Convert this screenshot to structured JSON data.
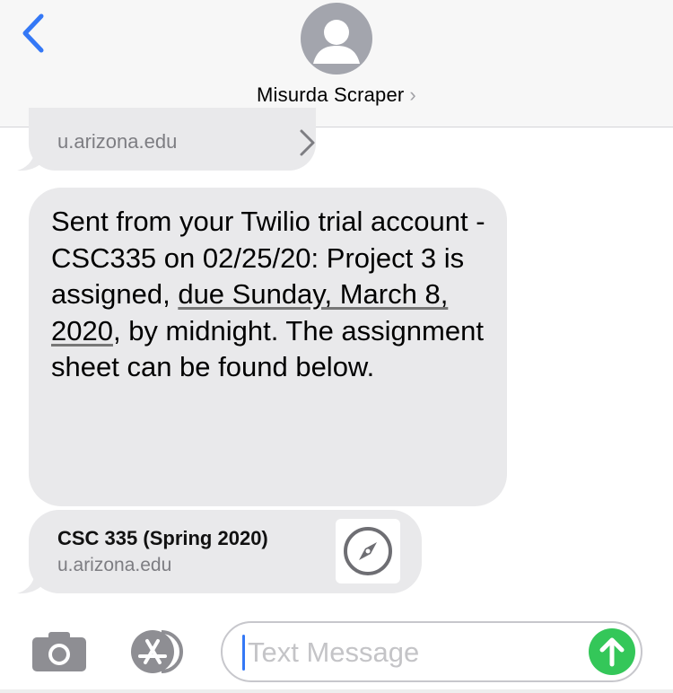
{
  "header": {
    "contact_name": "Misurda Scraper",
    "chevron": "›"
  },
  "messages": {
    "link_preview_top": {
      "domain": "u.arizona.edu"
    },
    "body": {
      "part1": "Sent from your Twilio trial account - CSC335 on 02/25/20: Project 3 is assigned, ",
      "date_link": "due Sunday, March 8, 2020",
      "part2": ", by midnight. The assignment sheet can be found below."
    },
    "link_card": {
      "title": "CSC 335 (Spring 2020)",
      "domain": "u.arizona.edu"
    }
  },
  "input_bar": {
    "placeholder": "Text Message"
  },
  "colors": {
    "accent": "#3478f6",
    "bubble": "#e9e9eb",
    "send": "#34c759"
  }
}
